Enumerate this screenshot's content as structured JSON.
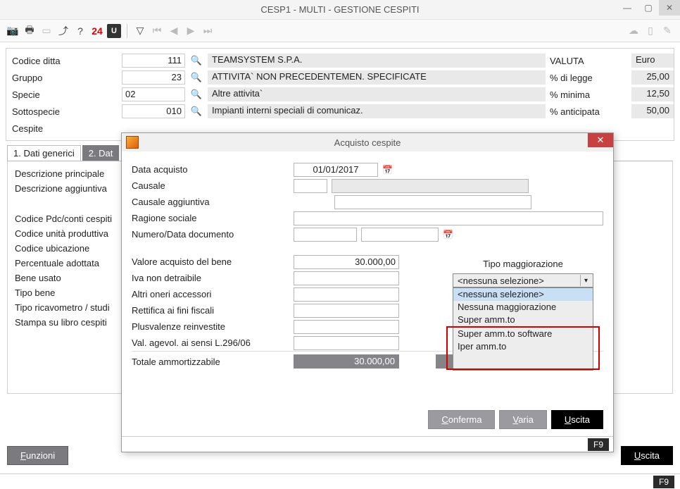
{
  "window": {
    "title": "CESP1  -  MULTI -   GESTIONE CESPITI"
  },
  "header": {
    "row1": {
      "label": "Codice ditta",
      "value": "111",
      "desc": "TEAMSYSTEM S.P.A.",
      "rlabel": "VALUTA",
      "rvalue": "Euro"
    },
    "row2": {
      "label": "Gruppo",
      "value": "23",
      "desc": "ATTIVITA`  NON PRECEDENTEMEN. SPECIFICATE",
      "rlabel": "% di legge",
      "rvalue": "25,00"
    },
    "row3": {
      "label": "Specie",
      "value": "02",
      "desc": "Altre attivita`",
      "rlabel": "% minima",
      "rvalue": "12,50"
    },
    "row4": {
      "label": "Sottospecie",
      "value": "010",
      "desc": "Impianti interni speciali di comunicaz.",
      "rlabel": "% anticipata",
      "rvalue": "50,00"
    },
    "row5": {
      "label": "Cespite"
    }
  },
  "tabs": {
    "tab1": "1. Dati generici",
    "tab2": "2. Dat"
  },
  "side": {
    "descPrincipale": "Descrizione principale",
    "descAgg": "Descrizione aggiuntiva",
    "codPdc": "Codice Pdc/conti cespiti",
    "codUP": "Codice unità produttiva",
    "codUb": "Codice ubicazione",
    "perc": "Percentuale adottata",
    "beneUsato": "Bene usato",
    "tipoBene": "Tipo bene",
    "tipoRic": "Tipo ricavometro / studi",
    "stampa": "Stampa su libro cespiti"
  },
  "bottom": {
    "funzioni": "Funzioni",
    "uscita": "Uscita",
    "f9": "F9"
  },
  "modal": {
    "title": "Acquisto cespite",
    "dataAcq_lbl": "Data acquisto",
    "dataAcq_val": "01/01/2017",
    "causale_lbl": "Causale",
    "causaleAgg_lbl": "Causale aggiuntiva",
    "ragSoc_lbl": "Ragione sociale",
    "numDoc_lbl": "Numero/Data documento",
    "valAcq_lbl": "Valore acquisto del bene",
    "valAcq_val": "30.000,00",
    "iva_lbl": "Iva non detraibile",
    "oneri_lbl": "Altri oneri accessori",
    "rett_lbl": "Rettifica ai fini fiscali",
    "plus_lbl": "Plusvalenze reinvestite",
    "valAgev_lbl": "Val. agevol. ai sensi L.296/06",
    "totale_lbl": "Totale ammortizzabile",
    "totale_val": "30.000,00",
    "conferma": "Conferma",
    "varia": "Varia",
    "uscita": "Uscita",
    "f9": "F9"
  },
  "dropdown": {
    "label": "Tipo maggiorazione",
    "selected": "<nessuna selezione>",
    "opt0": "<nessuna selezione>",
    "opt1": "Nessuna maggiorazione",
    "opt2": "Super amm.to",
    "opt3": "Super amm.to software",
    "opt4": "Iper amm.to"
  }
}
